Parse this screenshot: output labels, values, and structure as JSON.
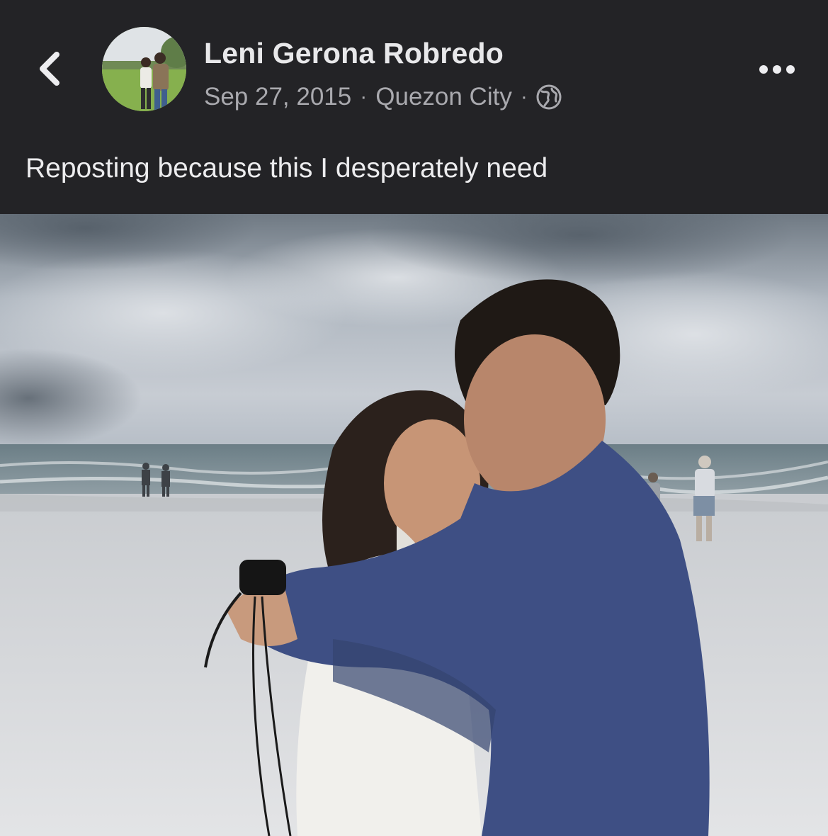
{
  "post": {
    "author_name": "Leni Gerona Robredo",
    "date": "Sep 27, 2015",
    "location": "Quezon City",
    "separator": "·",
    "privacy_icon": "globe-icon",
    "text": "Reposting because this I desperately need"
  },
  "nav": {
    "back_icon": "chevron-left-icon",
    "more_icon": "more-horizontal-icon"
  },
  "colors": {
    "background": "#232326",
    "name_text": "#e8e8ea",
    "meta_text": "#a9a9ae",
    "body_text": "#ececee"
  }
}
